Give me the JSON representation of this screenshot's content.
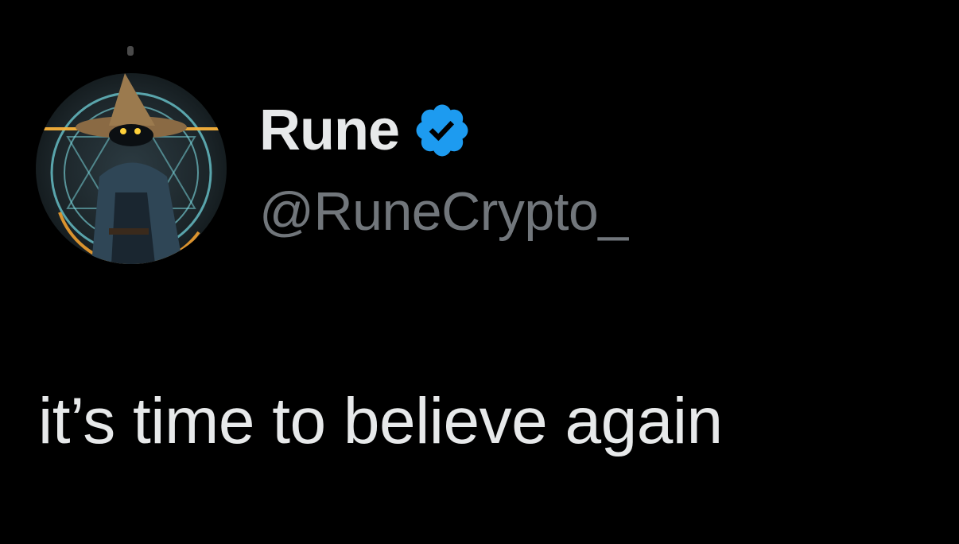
{
  "author": {
    "display_name": "Rune",
    "handle": "@RuneCrypto_",
    "verified": true,
    "avatar_icon": "wizard-avatar"
  },
  "tweet": {
    "text": "it’s time to believe again"
  },
  "colors": {
    "background": "#000000",
    "name": "#e7e9ea",
    "handle": "#71767b",
    "verified_badge": "#1d9bf0"
  }
}
